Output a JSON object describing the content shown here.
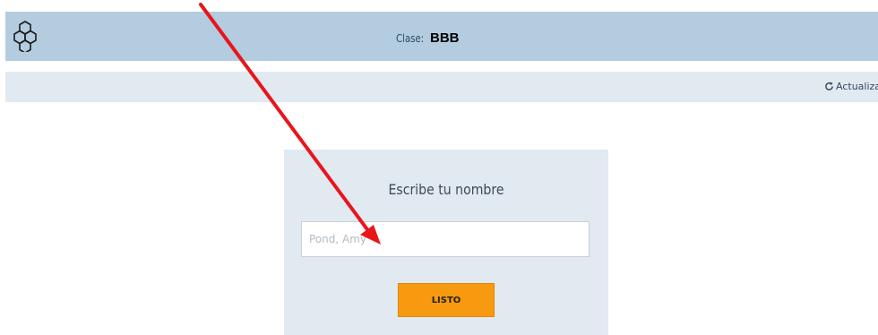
{
  "header": {
    "class_label": "Clase:",
    "class_value": "BBB",
    "logo_icon": "hexagon-cluster-icon",
    "background_color": "#b4cce0"
  },
  "subheader": {
    "refresh_label": "Actualizar",
    "refresh_icon": "refresh-icon",
    "background_color": "#e1e9f1"
  },
  "login_card": {
    "title": "Escribe tu nombre",
    "name_input": {
      "value": "",
      "placeholder": "Pond, Amy"
    },
    "ready_button_label": "LISTO",
    "button_color": "#f89a10"
  },
  "annotation": {
    "arrow_color": "#e8151b"
  }
}
